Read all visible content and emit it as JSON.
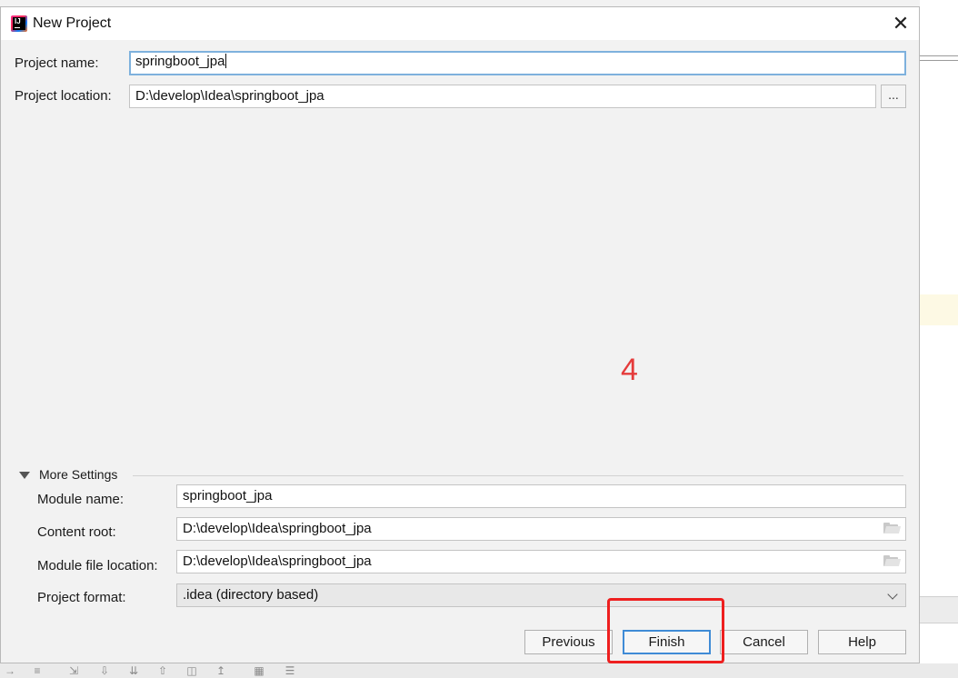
{
  "dialog": {
    "title": "New Project",
    "close_icon": "close-icon",
    "app_icon": "intellij-idea-icon",
    "app_icon_text": "IJ"
  },
  "project_name": {
    "label": "Project name:",
    "value": "springboot_jpa"
  },
  "project_location": {
    "label": "Project location:",
    "value": "D:\\develop\\Idea\\springboot_jpa",
    "browse_label": "..."
  },
  "annotation": {
    "step_number": "4",
    "color": "#e53b3b"
  },
  "more_settings": {
    "label": "More Settings",
    "expanded": true,
    "module_name": {
      "label": "Module name:",
      "value": "springboot_jpa"
    },
    "content_root": {
      "label": "Content root:",
      "value": "D:\\develop\\Idea\\springboot_jpa",
      "icon": "folder-icon"
    },
    "module_file_location": {
      "label": "Module file location:",
      "value": "D:\\develop\\Idea\\springboot_jpa",
      "icon": "folder-icon"
    },
    "project_format": {
      "label": "Project format:",
      "value": ".idea (directory based)"
    }
  },
  "buttons": {
    "previous": "Previous",
    "finish": "Finish",
    "cancel": "Cancel",
    "help": "Help"
  },
  "colors": {
    "focus_border": "#7eb1dd",
    "default_button_border": "#3f8bd6",
    "highlight_box": "#ee1f1f"
  }
}
